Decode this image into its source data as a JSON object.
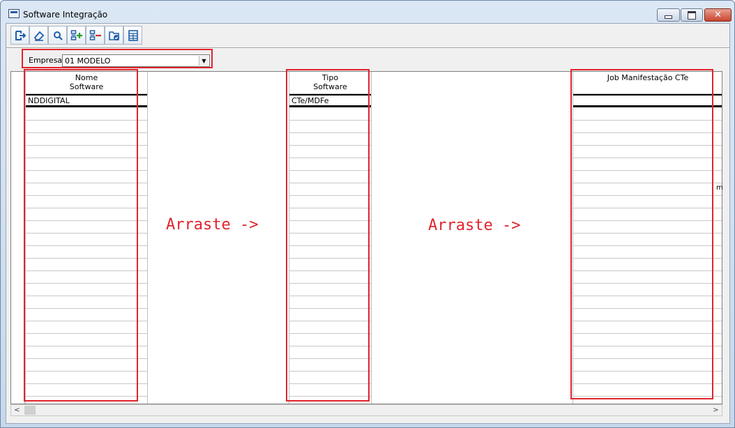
{
  "window": {
    "title": "Software Integração",
    "close_glyph": "✕"
  },
  "toolbar": {
    "buttons": [
      {
        "icon": "exit-icon"
      },
      {
        "icon": "eraser-icon"
      },
      {
        "icon": "search-icon"
      },
      {
        "icon": "add-row-icon"
      },
      {
        "icon": "remove-row-icon"
      },
      {
        "icon": "folder-check-icon"
      },
      {
        "icon": "table-icon"
      }
    ]
  },
  "filter": {
    "empresa_label": "Empresa",
    "empresa_value": "01 MODELO",
    "arrow_glyph": "▼"
  },
  "grid": {
    "columns": [
      {
        "header_line1": "Nome",
        "header_line2": "Software",
        "first_value": "NDDIGITAL"
      },
      {
        "header_line1": "Tipo",
        "header_line2": "Software",
        "first_value": "CTe/MDFe"
      },
      {
        "header_line1": "Job Manifestação CTe",
        "header_line2": "",
        "first_value": ""
      }
    ],
    "edge_char": "m"
  },
  "annotations": {
    "drag_label_1": "Arraste ->",
    "drag_label_2": "Arraste ->",
    "color": "#e0242c"
  },
  "scrollbar": {
    "left_glyph": "<",
    "right_glyph": ">"
  }
}
